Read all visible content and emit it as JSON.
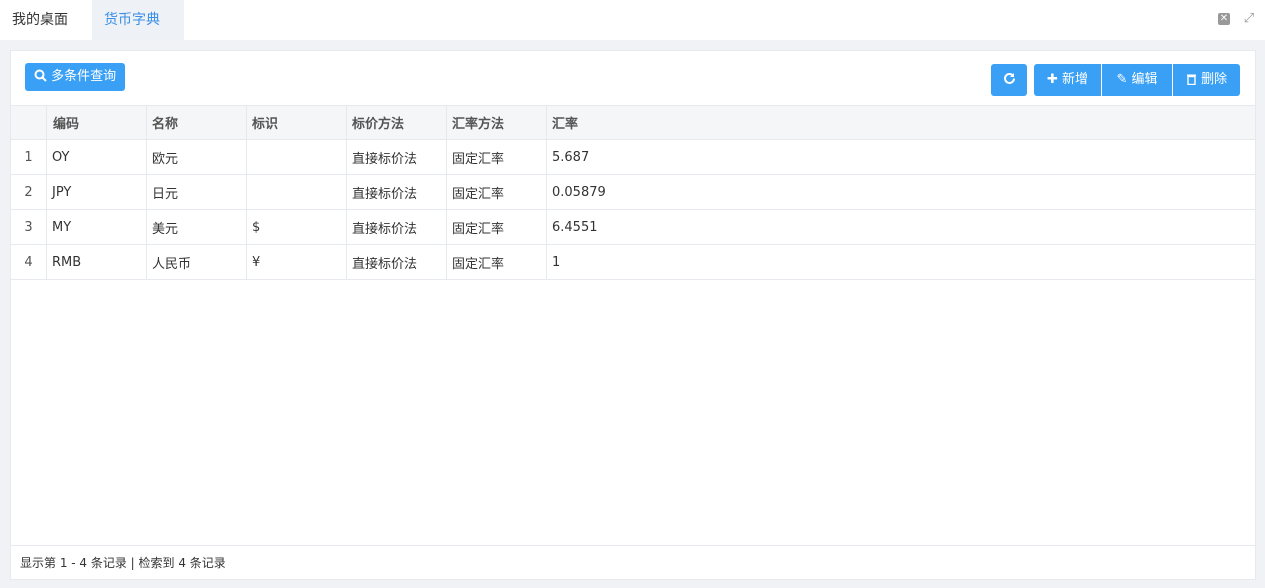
{
  "tabs": [
    "我的桌面",
    "货币字典"
  ],
  "toolbar": {
    "query_label": "多条件查询",
    "add_label": "新增",
    "edit_label": "编辑",
    "delete_label": "删除"
  },
  "table": {
    "columns": [
      "编码",
      "名称",
      "标识",
      "标价方法",
      "汇率方法",
      "汇率"
    ],
    "rows": [
      {
        "num": "1",
        "code": "OY",
        "name": "欧元",
        "symbol": "",
        "pricing": "直接标价法",
        "rate_method": "固定汇率",
        "rate": "5.687"
      },
      {
        "num": "2",
        "code": "JPY",
        "name": "日元",
        "symbol": "",
        "pricing": "直接标价法",
        "rate_method": "固定汇率",
        "rate": "0.05879"
      },
      {
        "num": "3",
        "code": "MY",
        "name": "美元",
        "symbol": "$",
        "pricing": "直接标价法",
        "rate_method": "固定汇率",
        "rate": "6.4551"
      },
      {
        "num": "4",
        "code": "RMB",
        "name": "人民币",
        "symbol": "¥",
        "pricing": "直接标价法",
        "rate_method": "固定汇率",
        "rate": "1"
      }
    ]
  },
  "footer": {
    "text": "显示第 1 - 4 条记录 | 检索到 4 条记录"
  },
  "colors": {
    "accent": "#3aa0f5",
    "active_tab": "#3a8ee6"
  }
}
